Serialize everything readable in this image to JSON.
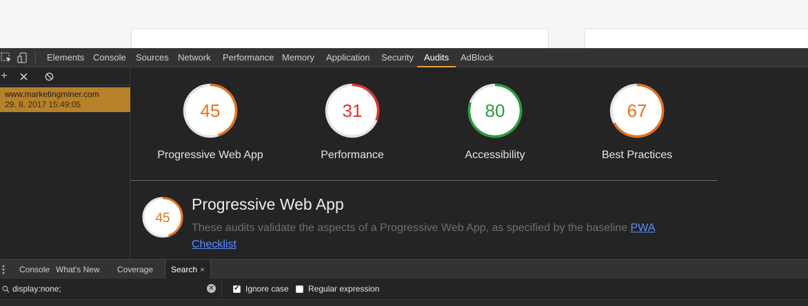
{
  "devtools": {
    "tabs": [
      {
        "label": "Elements",
        "active": false
      },
      {
        "label": "Console",
        "active": false
      },
      {
        "label": "Sources",
        "active": false
      },
      {
        "label": "Network",
        "active": false
      },
      {
        "label": "Performance",
        "active": false
      },
      {
        "label": "Memory",
        "active": false
      },
      {
        "label": "Application",
        "active": false
      },
      {
        "label": "Security",
        "active": false
      },
      {
        "label": "Audits",
        "active": true
      },
      {
        "label": "AdBlock",
        "active": false
      }
    ],
    "accent_color": "#f29f3b"
  },
  "reports_panel": {
    "items": [
      {
        "url": "www.marketingminer.com",
        "date": "29. 8. 2017 15:49:05",
        "selected": true
      }
    ]
  },
  "audit": {
    "gauges": [
      {
        "score": 45,
        "label": "Progressive Web App",
        "color": "#e8711a"
      },
      {
        "score": 31,
        "label": "Performance",
        "color": "#df332f"
      },
      {
        "score": 80,
        "label": "Accessibility",
        "color": "#2a9d3c"
      },
      {
        "score": 67,
        "label": "Best Practices",
        "color": "#e8711a"
      }
    ],
    "category": {
      "score": 45,
      "color": "#e8711a",
      "title": "Progressive Web App",
      "description": "These audits validate the aspects of a Progressive Web App, as specified by the baseline",
      "link_text": "PWA Checklist"
    }
  },
  "drawer": {
    "tabs": [
      {
        "label": "Console",
        "active": false
      },
      {
        "label": "What's New",
        "active": false
      },
      {
        "label": "Coverage",
        "active": false
      },
      {
        "label": "Search",
        "active": true
      }
    ],
    "search": {
      "value": "display:none;",
      "ignore_case_label": "Ignore case",
      "ignore_case_checked": true,
      "regex_label": "Regular expression",
      "regex_checked": false
    }
  }
}
